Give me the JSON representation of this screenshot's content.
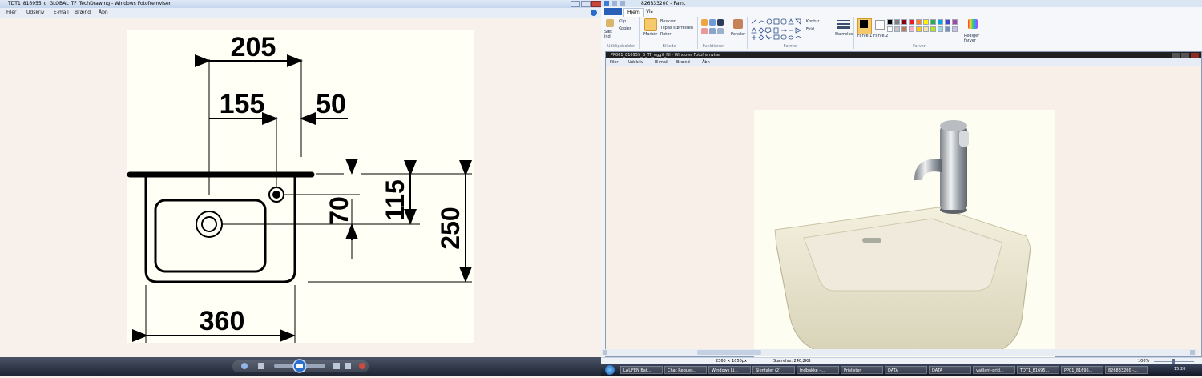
{
  "left_window": {
    "title": "TDT1_816955_d_GLOBAL_TF_TechDrawing - Windows Fotofremviser",
    "menu": [
      "Filer",
      "Udskriv",
      "E-mail",
      "Brænd",
      "Åbn"
    ],
    "drawing": {
      "dim_top": "205",
      "dim_left": "155",
      "dim_right": "50",
      "dim_70": "70",
      "dim_115": "115",
      "dim_250": "250",
      "dim_bottom": "360"
    }
  },
  "paint": {
    "title": "826833200 - Paint",
    "tabs": [
      "Hjem",
      "Vis"
    ],
    "groups": {
      "clipboard": {
        "label": "Udklipsholder",
        "paste": "Sæt ind",
        "cut": "Klip",
        "copy": "Kopier"
      },
      "image": {
        "label": "Billede",
        "select": "Markér",
        "crop": "Beskær",
        "resize": "Tilpas størrelsen",
        "rotate": "Roter"
      },
      "tools": {
        "label": "Funktioner"
      },
      "brushes": {
        "label": "Pensler"
      },
      "shapes": {
        "label": "Former",
        "outline": "Kontur",
        "fill": "Fyld"
      },
      "size": {
        "label": "Størrelse"
      },
      "colors": {
        "label": "Farver",
        "color1": "Farve 1",
        "color2": "Farve 2",
        "edit": "Rediger farver"
      }
    },
    "palette": [
      "#000000",
      "#7f7f7f",
      "#880015",
      "#ed1c24",
      "#ff7f27",
      "#fff200",
      "#22b14c",
      "#00a2e8",
      "#3f48cc",
      "#a349a4",
      "#ffffff",
      "#c3c3c3",
      "#b97a57",
      "#ffaec9",
      "#ffc90e",
      "#efe4b0",
      "#b5e61d",
      "#99d9ea",
      "#7092be",
      "#c8bfe7"
    ],
    "inner_title": "PP001_816955_B_TF_eggit_Fil - Windows Fotofremviser",
    "inner_menu": [
      "Filer",
      "Udskriv",
      "E-mail",
      "Brænd",
      "Åbn"
    ],
    "status": {
      "dimensions": "2360 × 1050px",
      "filesize": "Størrelse: 240,2KB",
      "zoom": "100%"
    }
  },
  "taskbar": {
    "items": [
      "LAUFEN Bat...",
      "Chat Reques...",
      "Windows Li...",
      "Sientaler (2)",
      "Indbakke -...",
      "Prislister",
      "DATA",
      "DATA",
      "vaillant-prid...",
      "TDT1_81695...",
      "PP01_81695...",
      "826833200 -..."
    ],
    "clock": "15:26"
  }
}
